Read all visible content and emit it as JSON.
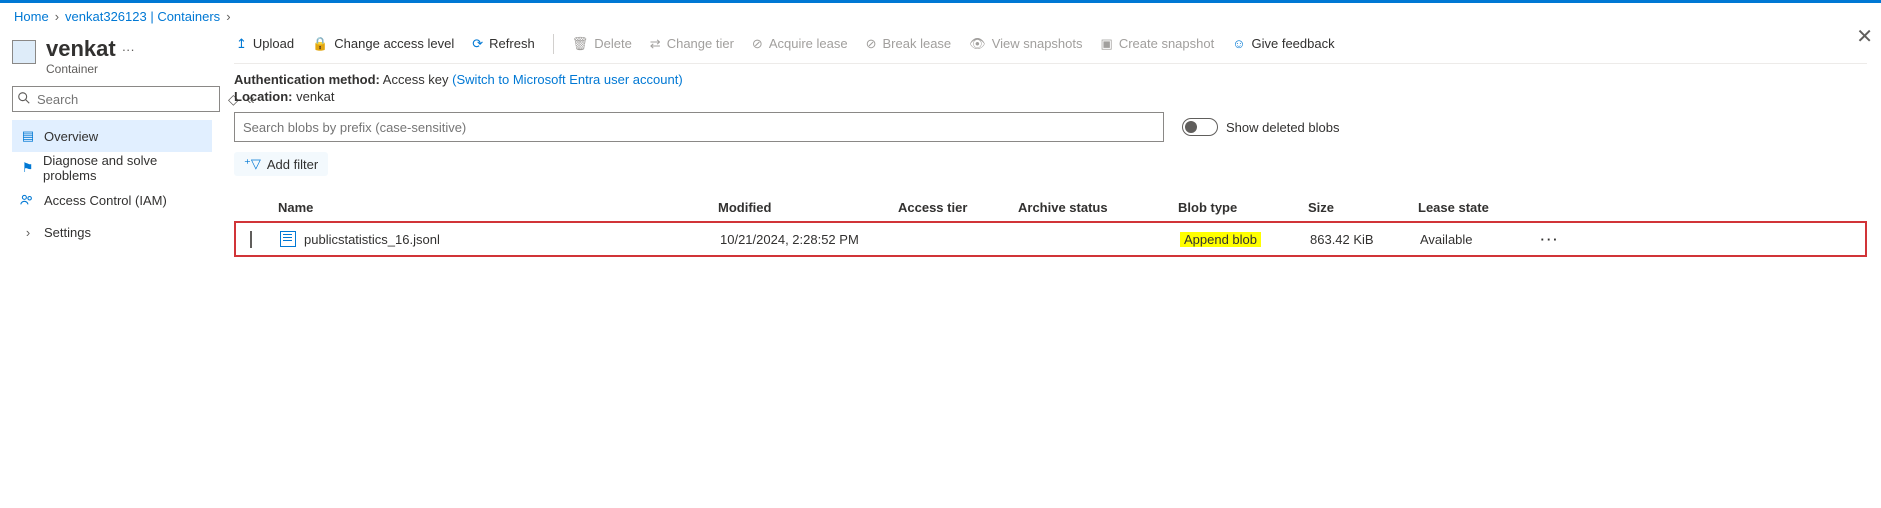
{
  "breadcrumb": {
    "home": "Home",
    "storage": "venkat326123 | Containers"
  },
  "header": {
    "title": "venkat",
    "subtitle": "Container"
  },
  "search": {
    "placeholder": "Search"
  },
  "nav": {
    "overview": "Overview",
    "diagnose": "Diagnose and solve problems",
    "iam": "Access Control (IAM)",
    "settings": "Settings"
  },
  "toolbar": {
    "upload": "Upload",
    "access": "Change access level",
    "refresh": "Refresh",
    "delete": "Delete",
    "tier": "Change tier",
    "acquire": "Acquire lease",
    "break": "Break lease",
    "snaps": "View snapshots",
    "create": "Create snapshot",
    "feedback": "Give feedback"
  },
  "info": {
    "auth_k": "Authentication method:",
    "auth_v": "Access key",
    "auth_sw": "(Switch to Microsoft Entra user account)",
    "loc_k": "Location:",
    "loc_v": "venkat"
  },
  "filter": {
    "placeholder": "Search blobs by prefix (case-sensitive)",
    "show_deleted": "Show deleted blobs",
    "add_filter": "Add filter"
  },
  "grid": {
    "cols": {
      "name": "Name",
      "mod": "Modified",
      "tier": "Access tier",
      "arch": "Archive status",
      "type": "Blob type",
      "size": "Size",
      "lease": "Lease state"
    },
    "rows": [
      {
        "name": "publicstatistics_16.jsonl",
        "mod": "10/21/2024, 2:28:52 PM",
        "tier": "",
        "arch": "",
        "type": "Append blob",
        "size": "863.42 KiB",
        "lease": "Available"
      }
    ]
  }
}
